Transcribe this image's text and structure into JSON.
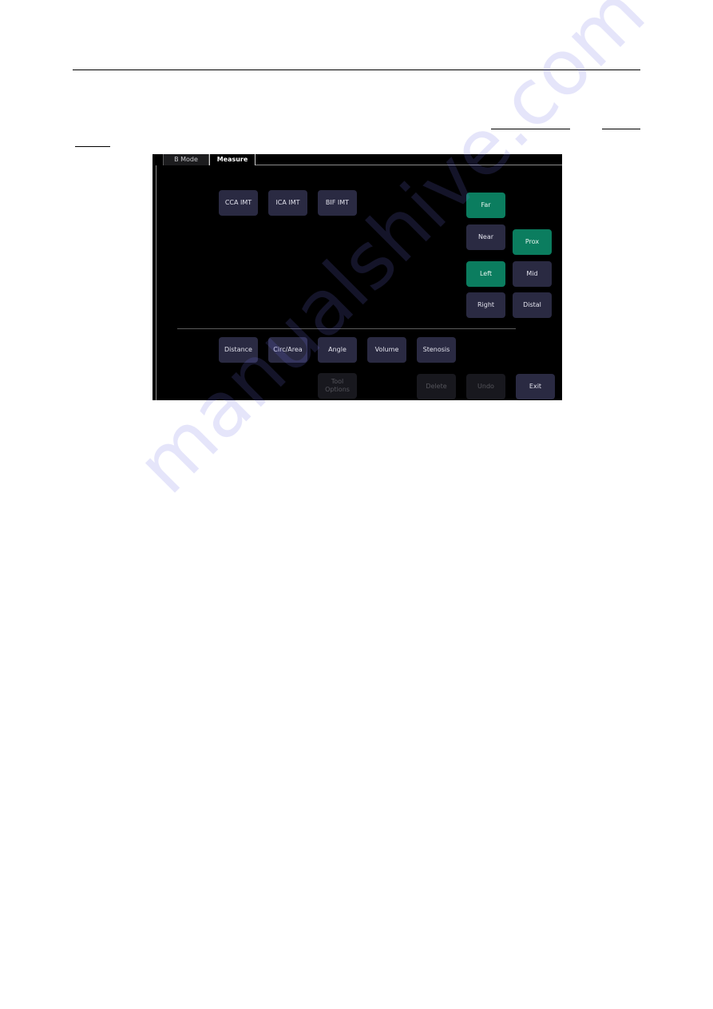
{
  "document": {
    "links": [
      "",
      "",
      ""
    ]
  },
  "screenshot": {
    "tabs": [
      {
        "label": "B Mode",
        "active": false
      },
      {
        "label": "Measure",
        "active": true
      }
    ],
    "imt_buttons": [
      "CCA IMT",
      "ICA IMT",
      "BIF IMT"
    ],
    "wall_buttons": [
      {
        "label": "Far",
        "selected": true
      },
      {
        "label": "Near",
        "selected": false
      }
    ],
    "side_buttons": [
      {
        "label": "Left",
        "selected": true
      },
      {
        "label": "Right",
        "selected": false
      }
    ],
    "segment_buttons": [
      {
        "label": "Prox",
        "selected": true
      },
      {
        "label": "Mid",
        "selected": false
      },
      {
        "label": "Distal",
        "selected": false
      }
    ],
    "tool_buttons": [
      "Distance",
      "Circ/Area",
      "Angle",
      "Volume",
      "Stenosis"
    ],
    "action_buttons": {
      "tool_options": "Tool Options",
      "delete": "Delete",
      "undo": "Undo",
      "exit": "Exit"
    },
    "colors": {
      "selected": "#0b7d5f",
      "button": "#2a2a42",
      "disabled": "#18181e",
      "background": "#000000"
    }
  },
  "watermark": "manualshive.com"
}
